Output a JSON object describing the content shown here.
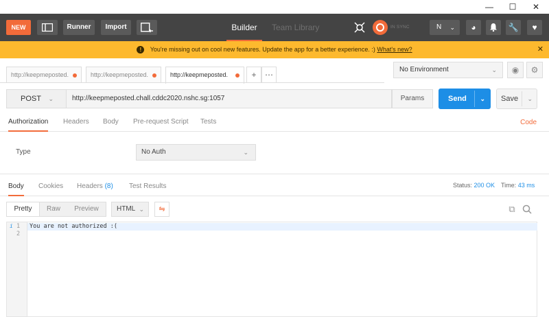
{
  "window": {
    "minimize": "—",
    "maximize": "☐",
    "close": "✕"
  },
  "header": {
    "new_label": "NEW",
    "runner_label": "Runner",
    "import_label": "Import",
    "tabs": [
      {
        "label": "Builder"
      },
      {
        "label": "Team Library"
      }
    ],
    "sync_text": "IN SYNC",
    "user_initial": "N"
  },
  "banner": {
    "message": "You're missing out on cool new features. Update the app for a better experience. :)",
    "link": "What's new?",
    "close": "✕"
  },
  "request_tabs": [
    {
      "label": "http://keepmeposted."
    },
    {
      "label": "http://keepmeposted."
    },
    {
      "label": "http://keepmeposted."
    }
  ],
  "environment": {
    "selected": "No Environment"
  },
  "request": {
    "method": "POST",
    "url": "http://keepmeposted.chall.cddc2020.nshc.sg:1057",
    "params_label": "Params",
    "send_label": "Send",
    "save_label": "Save"
  },
  "request_subtabs": [
    {
      "label": "Authorization"
    },
    {
      "label": "Headers"
    },
    {
      "label": "Body"
    },
    {
      "label": "Pre-request Script"
    },
    {
      "label": "Tests"
    }
  ],
  "code_label": "Code",
  "auth": {
    "type_label": "Type",
    "type_value": "No Auth"
  },
  "response_tabs": [
    {
      "label": "Body"
    },
    {
      "label": "Cookies"
    },
    {
      "label": "Headers",
      "count": "(8)"
    },
    {
      "label": "Test Results"
    }
  ],
  "response_status": {
    "status_label": "Status:",
    "status_value": "200 OK",
    "time_label": "Time:",
    "time_value": "43 ms"
  },
  "view_modes": [
    {
      "label": "Pretty"
    },
    {
      "label": "Raw"
    },
    {
      "label": "Preview"
    }
  ],
  "format": {
    "selected": "HTML"
  },
  "editor": {
    "lines": [
      {
        "num": "1",
        "text": "You are not authorized :("
      },
      {
        "num": "2",
        "text": ""
      }
    ]
  },
  "colors": {
    "accent": "#f26b3a",
    "primary": "#1d8ee6",
    "banner": "#fdb92e",
    "header_bg": "#444444"
  }
}
